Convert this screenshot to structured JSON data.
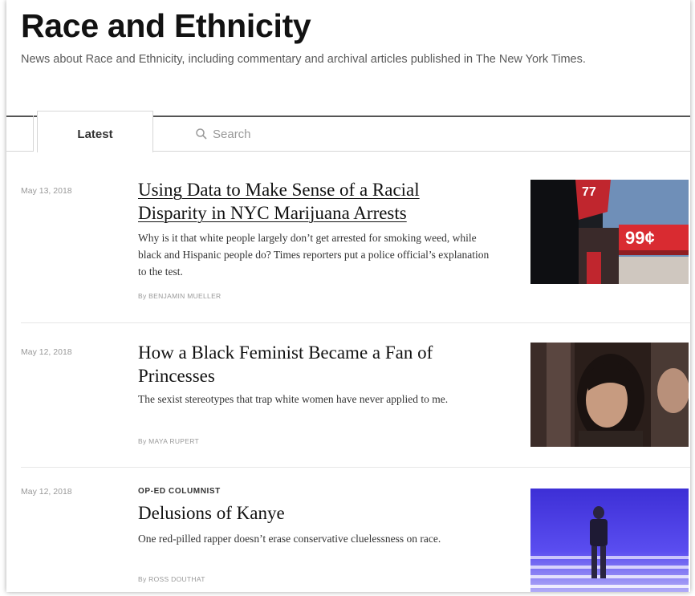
{
  "section": {
    "title": "Race and Ethnicity",
    "description": "News about Race and Ethnicity, including commentary and archival articles published in The New York Times."
  },
  "tabs": {
    "latest_label": "Latest",
    "search_label": "Search"
  },
  "articles": [
    {
      "date": "May 13, 2018",
      "kicker": "",
      "headline": "Using Data to Make Sense of a Racial Disparity in NYC Marijuana Arrests",
      "summary": "Why is it that white people largely don’t get arrested for smoking weed, while black and Hispanic people do? Times reporters put a police official’s explanation to the test.",
      "byline": "By BENJAMIN MUELLER",
      "image_text": "99¢"
    },
    {
      "date": "May 12, 2018",
      "kicker": "",
      "headline": "How a Black Feminist Became a Fan of Princesses",
      "summary": "The sexist stereotypes that trap white women have never applied to me.",
      "byline": "By MAYA RUPERT"
    },
    {
      "date": "May 12, 2018",
      "kicker": "OP-ED COLUMNIST",
      "headline": "Delusions of Kanye",
      "summary": "One red-pilled rapper doesn’t erase conservative cluelessness on race.",
      "byline": "By ROSS DOUTHAT"
    }
  ],
  "colors": {
    "text": "#121212",
    "muted": "#999999",
    "rule": "#e6e6e6"
  }
}
